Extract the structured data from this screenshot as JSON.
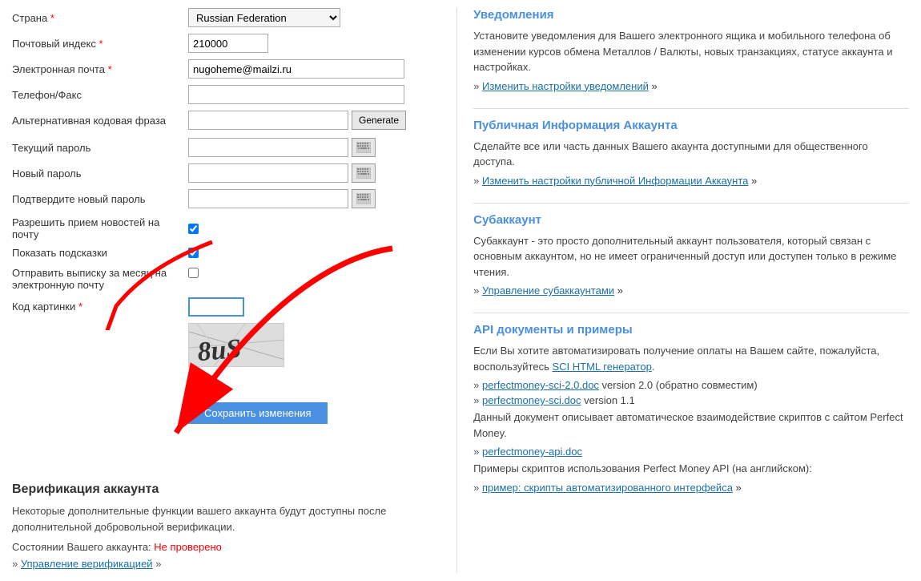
{
  "left": {
    "country_label": "Страна",
    "country_value": "Russian Federation",
    "postal_label": "Почтовый индекс",
    "postal_value": "210000",
    "email_label": "Электронная почта",
    "email_value": "nugoheme@mailzi.ru",
    "phone_label": "Телефон/Факс",
    "phone_value": "",
    "alt_code_label": "Альтернативная кодовая фраза",
    "alt_code_value": "",
    "generate_label": "Generate",
    "current_pass_label": "Текущий пароль",
    "new_pass_label": "Новый пароль",
    "confirm_pass_label": "Подтвердите новый пароль",
    "newsletter_label": "Разрешить прием новостей на почту",
    "hints_label": "Показать подсказки",
    "monthly_label": "Отправить выписку за месяц на электронную почту",
    "captcha_label": "Код картинки",
    "captcha_value": "",
    "captcha_text": "8uS",
    "save_label": "Сохранить изменения",
    "verification_title": "Верификация аккаунта",
    "verification_text": "Некоторые дополнительные функции вашего аккаунта будут доступны после дополнительной добровольной верификации.",
    "status_label": "Состоянии Вашего аккаунта:",
    "status_value": "Не проверено",
    "manage_link": "Управление верификацией"
  },
  "right": {
    "notifications_title": "Уведомления",
    "notifications_text": "Установите уведомления для Вашего электронного ящика и мобильного телефона об изменении курсов обмена Металлов / Валюты, новых транзакциях, статусе аккаунта и настройках.",
    "notifications_link": "Изменить настройки уведомлений",
    "public_title": "Публичная Информация Аккаунта",
    "public_text": "Сделайте все или часть данных Вашего акаунта доступными для общественного доступа.",
    "public_link": "Изменить настройки публичной Информации Аккаунта",
    "subaccount_title": "Субаккаунт",
    "subaccount_text": "Субаккаунт - это просто дополнительный аккаунт пользователя, который связан с основным аккаунтом, но не имеет ограниченный доступ или доступен только в режиме чтения.",
    "subaccount_link": "Управление субаккаунтами",
    "api_title": "API документы и примеры",
    "api_text1": "Если Вы хотите автоматизировать получение оплаты на Вашем сайте, пожалуйста, воспользуйтесь",
    "api_sci_link": "SCI HTML генератор",
    "api_text1_end": ".",
    "api_doc1_link": "perfectmoney-sci-2.0.doc",
    "api_doc1_after": "version 2.0 (обратно совместим)",
    "api_doc2_link": "perfectmoney-sci.doc",
    "api_doc2_after": "version 1.1",
    "api_text2": "Данный документ описывает автоматическое взаимодействие скриптов с сайтом Perfect Money.",
    "api_doc3_link": "perfectmoney-api.doc",
    "api_text3": "Примеры скриптов использования Perfect Money API (на английском):",
    "api_example_link": "пример: скрипты автоматизированного интерфейса"
  }
}
